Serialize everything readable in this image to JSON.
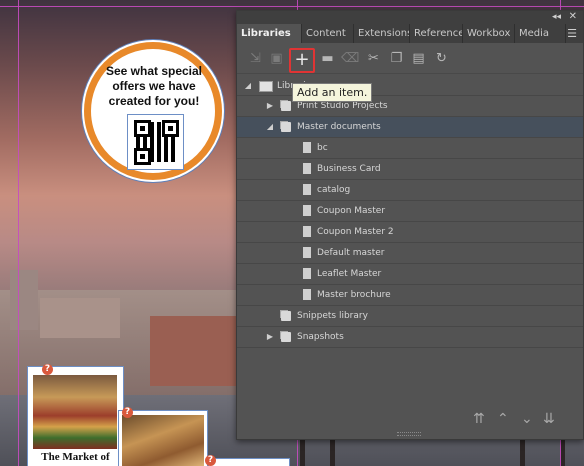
{
  "document": {
    "badge_text": "See what special offers we have created for you!",
    "market_caption": "The Market of",
    "qmark": "?"
  },
  "panel": {
    "collapse_glyph": "◂◂",
    "close_glyph": "✕",
    "menu_icon": "menu-icon",
    "tabs": [
      {
        "label": "Libraries",
        "active": true
      },
      {
        "label": "Content",
        "active": false
      },
      {
        "label": "Extensions",
        "active": false
      },
      {
        "label": "References",
        "active": false
      },
      {
        "label": "Workbox",
        "active": false
      },
      {
        "label": "Media",
        "active": false
      }
    ],
    "toolbar": {
      "icons": [
        "place-icon",
        "save-icon",
        "add-icon",
        "folder-icon",
        "delete-icon",
        "cut-icon",
        "copy-icon",
        "paste-icon",
        "refresh-icon"
      ]
    },
    "tooltip": "Add an item.",
    "tree": {
      "root": {
        "label": "Libraries",
        "expanded": true
      },
      "items": [
        {
          "label": "Print Studio Projects",
          "type": "folder",
          "expanded": false
        },
        {
          "label": "Master documents",
          "type": "folder",
          "expanded": true,
          "selected": true
        },
        {
          "label": "bc",
          "type": "document"
        },
        {
          "label": "Business Card",
          "type": "document"
        },
        {
          "label": "catalog",
          "type": "document"
        },
        {
          "label": "Coupon Master",
          "type": "document"
        },
        {
          "label": "Coupon Master 2",
          "type": "document"
        },
        {
          "label": "Default master",
          "type": "document"
        },
        {
          "label": "Leaflet Master",
          "type": "document"
        },
        {
          "label": "Master brochure",
          "type": "document"
        },
        {
          "label": "Snippets library",
          "type": "folder",
          "expanded": false
        },
        {
          "label": "Snapshots",
          "type": "folder",
          "expanded": false
        }
      ]
    },
    "footer_icons": [
      "move-top-icon",
      "move-up-icon",
      "move-down-icon",
      "move-bottom-icon"
    ]
  },
  "colors": {
    "accent_highlight": "#e03434",
    "badge_ring": "#e8892a",
    "panel_bg": "#535353",
    "selected_row": "#46505c"
  }
}
